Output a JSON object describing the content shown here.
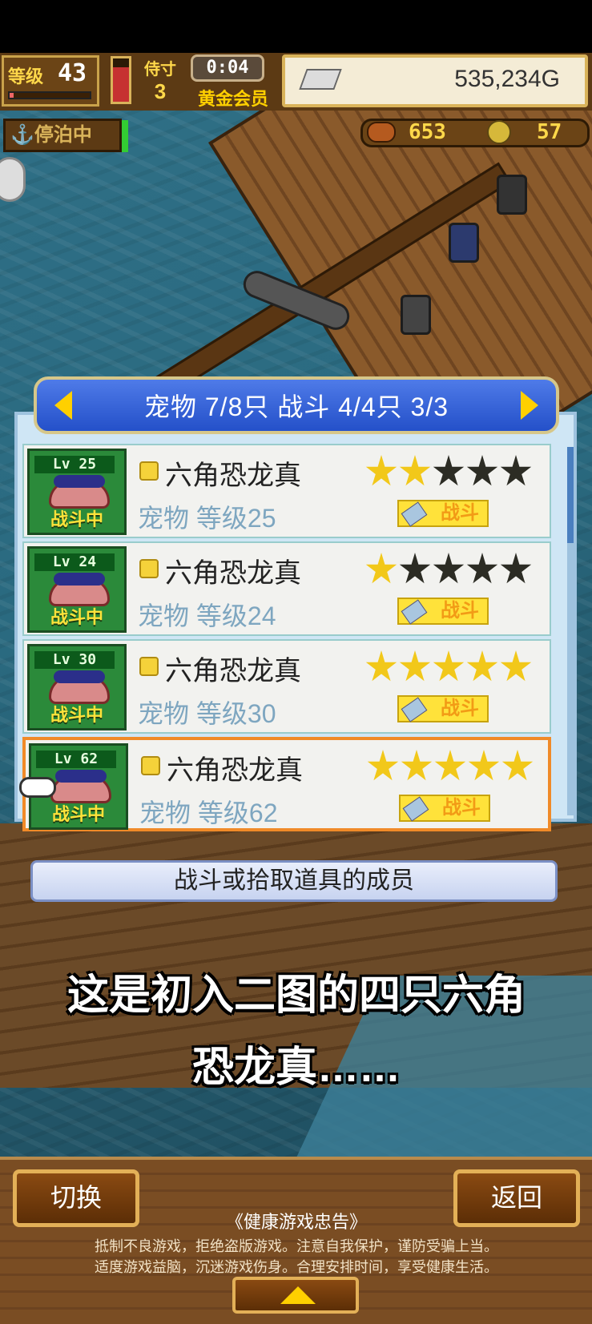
{
  "hud": {
    "level_label": "等级",
    "level": "43",
    "trophy_label": "侍寸",
    "trophy_count": "3",
    "clock": "0:04",
    "membership": "黄金会员",
    "gold": "535,234G",
    "dock_status": "停泊中",
    "food": "653",
    "coins": "57",
    "xp_fraction": 0.05,
    "gauge_fraction": 0.8
  },
  "dialog": {
    "title": "宠物 7/8只 战斗 4/4只  3/3",
    "description": "战斗或拾取道具的成员",
    "pets": [
      {
        "lv_badge": "Lv 25",
        "status": "战斗中",
        "name": "六角恐龙真",
        "level_text": "宠物 等级25",
        "stars": 2,
        "role": "战斗",
        "selected": false
      },
      {
        "lv_badge": "Lv 24",
        "status": "战斗中",
        "name": "六角恐龙真",
        "level_text": "宠物 等级24",
        "stars": 1,
        "role": "战斗",
        "selected": false
      },
      {
        "lv_badge": "Lv 30",
        "status": "战斗中",
        "name": "六角恐龙真",
        "level_text": "宠物 等级30",
        "stars": 5,
        "role": "战斗",
        "selected": false
      },
      {
        "lv_badge": "Lv 62",
        "status": "战斗中",
        "name": "六角恐龙真",
        "level_text": "宠物 等级62",
        "stars": 5,
        "role": "战斗",
        "selected": true
      }
    ]
  },
  "caption": {
    "line1": "这是初入二图的四只六角",
    "line2": "恐龙真……"
  },
  "bottom": {
    "switch_label": "切换",
    "back_label": "返回",
    "notice_title": "《健康游戏忠告》",
    "notice_line1": "抵制不良游戏，拒绝盗版游戏。注意自我保护，谨防受骗上当。",
    "notice_line2": "适度游戏益脑，沉迷游戏伤身。合理安排时间，享受健康生活。"
  },
  "colors": {
    "title_bar": "#2450c9",
    "gold_star": "#f2c81a",
    "selected_border": "#f08a28",
    "thumb_green": "#2b8a3a"
  }
}
